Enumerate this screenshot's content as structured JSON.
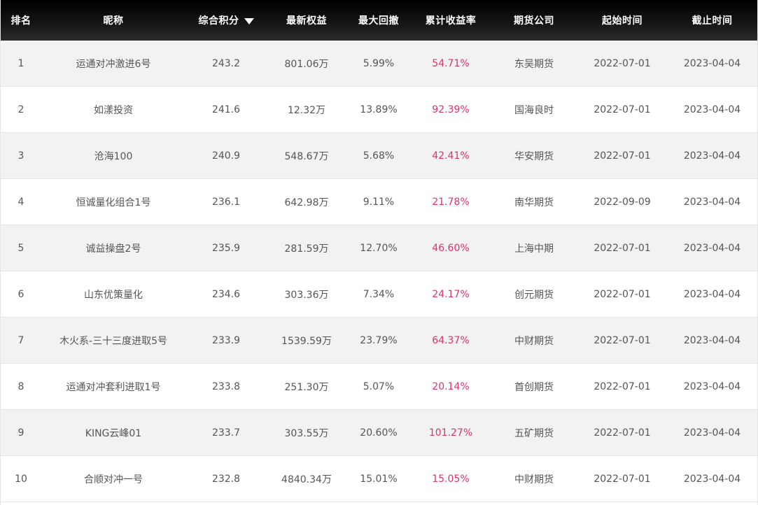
{
  "headers": {
    "rank": "排名",
    "name": "昵称",
    "score": "综合积分",
    "equity": "最新权益",
    "drawdown": "最大回撤",
    "return": "累计收益率",
    "company": "期货公司",
    "start": "起始时间",
    "end": "截止时间"
  },
  "sort": {
    "icon": "sort-desc-icon",
    "column": "score"
  },
  "colors": {
    "accent_return": "#e0306f",
    "header_bg": "#000000",
    "row_alt": "#f2f2f2"
  },
  "rows": [
    {
      "rank": "1",
      "name": "运通对冲激进6号",
      "score": "243.2",
      "equity": "801.06万",
      "drawdown": "5.99%",
      "return": "54.71%",
      "company": "东吴期货",
      "start": "2022-07-01",
      "end": "2023-04-04"
    },
    {
      "rank": "2",
      "name": "如漾投资",
      "score": "241.6",
      "equity": "12.32万",
      "drawdown": "13.89%",
      "return": "92.39%",
      "company": "国海良时",
      "start": "2022-07-01",
      "end": "2023-04-04"
    },
    {
      "rank": "3",
      "name": "沧海100",
      "score": "240.9",
      "equity": "548.67万",
      "drawdown": "5.68%",
      "return": "42.41%",
      "company": "华安期货",
      "start": "2022-07-01",
      "end": "2023-04-04"
    },
    {
      "rank": "4",
      "name": "恒诚量化组合1号",
      "score": "236.1",
      "equity": "642.98万",
      "drawdown": "9.11%",
      "return": "21.78%",
      "company": "南华期货",
      "start": "2022-09-09",
      "end": "2023-04-04"
    },
    {
      "rank": "5",
      "name": "诚益操盘2号",
      "score": "235.9",
      "equity": "281.59万",
      "drawdown": "12.70%",
      "return": "46.60%",
      "company": "上海中期",
      "start": "2022-07-01",
      "end": "2023-04-04"
    },
    {
      "rank": "6",
      "name": "山东优策量化",
      "score": "234.6",
      "equity": "303.36万",
      "drawdown": "7.34%",
      "return": "24.17%",
      "company": "创元期货",
      "start": "2022-07-01",
      "end": "2023-04-04"
    },
    {
      "rank": "7",
      "name": "木火系-三十三度进取5号",
      "score": "233.9",
      "equity": "1539.59万",
      "drawdown": "23.79%",
      "return": "64.37%",
      "company": "中财期货",
      "start": "2022-07-01",
      "end": "2023-04-04"
    },
    {
      "rank": "8",
      "name": "运通对冲套利进取1号",
      "score": "233.8",
      "equity": "251.30万",
      "drawdown": "5.07%",
      "return": "20.14%",
      "company": "首创期货",
      "start": "2022-07-01",
      "end": "2023-04-04"
    },
    {
      "rank": "9",
      "name": "KING云峰01",
      "score": "233.7",
      "equity": "303.55万",
      "drawdown": "20.60%",
      "return": "101.27%",
      "company": "五矿期货",
      "start": "2022-07-01",
      "end": "2023-04-04"
    },
    {
      "rank": "10",
      "name": "合顺对冲一号",
      "score": "232.8",
      "equity": "4840.34万",
      "drawdown": "15.01%",
      "return": "15.05%",
      "company": "中财期货",
      "start": "2022-07-01",
      "end": "2023-04-04"
    }
  ]
}
